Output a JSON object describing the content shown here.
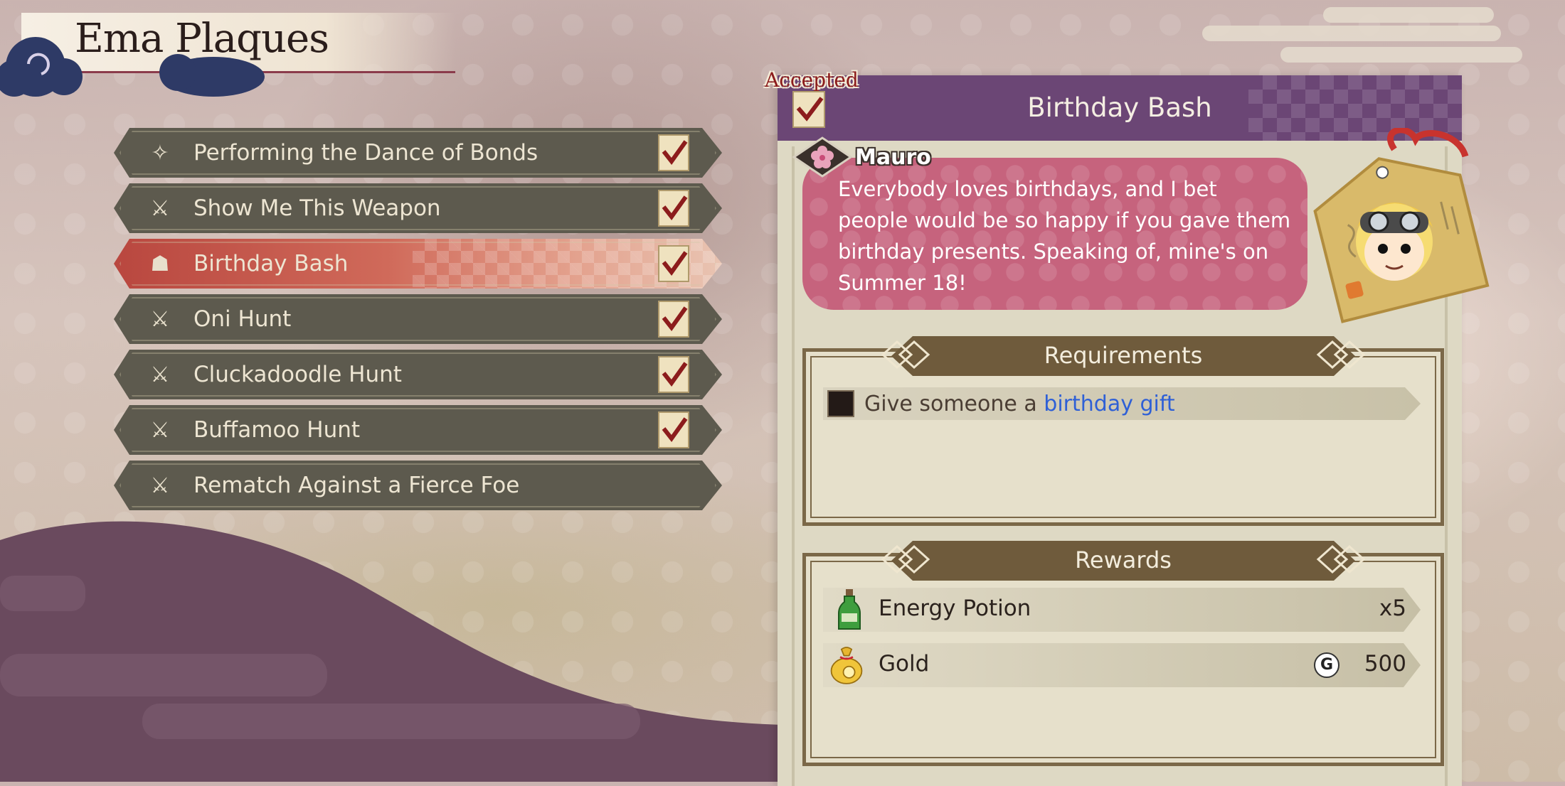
{
  "screen": {
    "title": "Ema Plaques"
  },
  "quests": [
    {
      "label": "Performing the Dance of Bonds",
      "icon": "sparkle-icon",
      "checked": true,
      "selected": false
    },
    {
      "label": "Show Me This Weapon",
      "icon": "crossed-swords-icon",
      "checked": true,
      "selected": false
    },
    {
      "label": "Birthday Bash",
      "icon": "person-icon",
      "checked": true,
      "selected": true
    },
    {
      "label": "Oni Hunt",
      "icon": "crossed-swords-icon",
      "checked": true,
      "selected": false
    },
    {
      "label": "Cluckadoodle Hunt",
      "icon": "crossed-swords-icon",
      "checked": true,
      "selected": false
    },
    {
      "label": "Buffamoo Hunt",
      "icon": "crossed-swords-icon",
      "checked": true,
      "selected": false
    },
    {
      "label": "Rematch Against a Fierce Foe",
      "icon": "crossed-swords-icon",
      "checked": false,
      "selected": false
    }
  ],
  "detail": {
    "status": "Accepted",
    "title": "Birthday Bash",
    "npc_name": "Mauro",
    "message": "Everybody loves birthdays, and I bet people would be so happy if you gave them birthday presents. Speaking of, mine's on Summer 18!",
    "requirements": {
      "heading": "Requirements",
      "items": [
        {
          "prefix": "Give someone a ",
          "link": "birthday gift",
          "done": false
        }
      ]
    },
    "rewards": {
      "heading": "Rewards",
      "items": [
        {
          "name": "Energy Potion",
          "quantity": "x5",
          "icon": "potion-bottle-icon"
        },
        {
          "name": "Gold",
          "quantity": "500",
          "currency_symbol": "G",
          "icon": "gold-bag-icon"
        }
      ]
    }
  },
  "colors": {
    "header_purple": "#6b4675",
    "selected_red": "#b9473f",
    "speech_pink": "#c6637d",
    "link_blue": "#2f60d6",
    "check_red": "#8c1c1c"
  }
}
